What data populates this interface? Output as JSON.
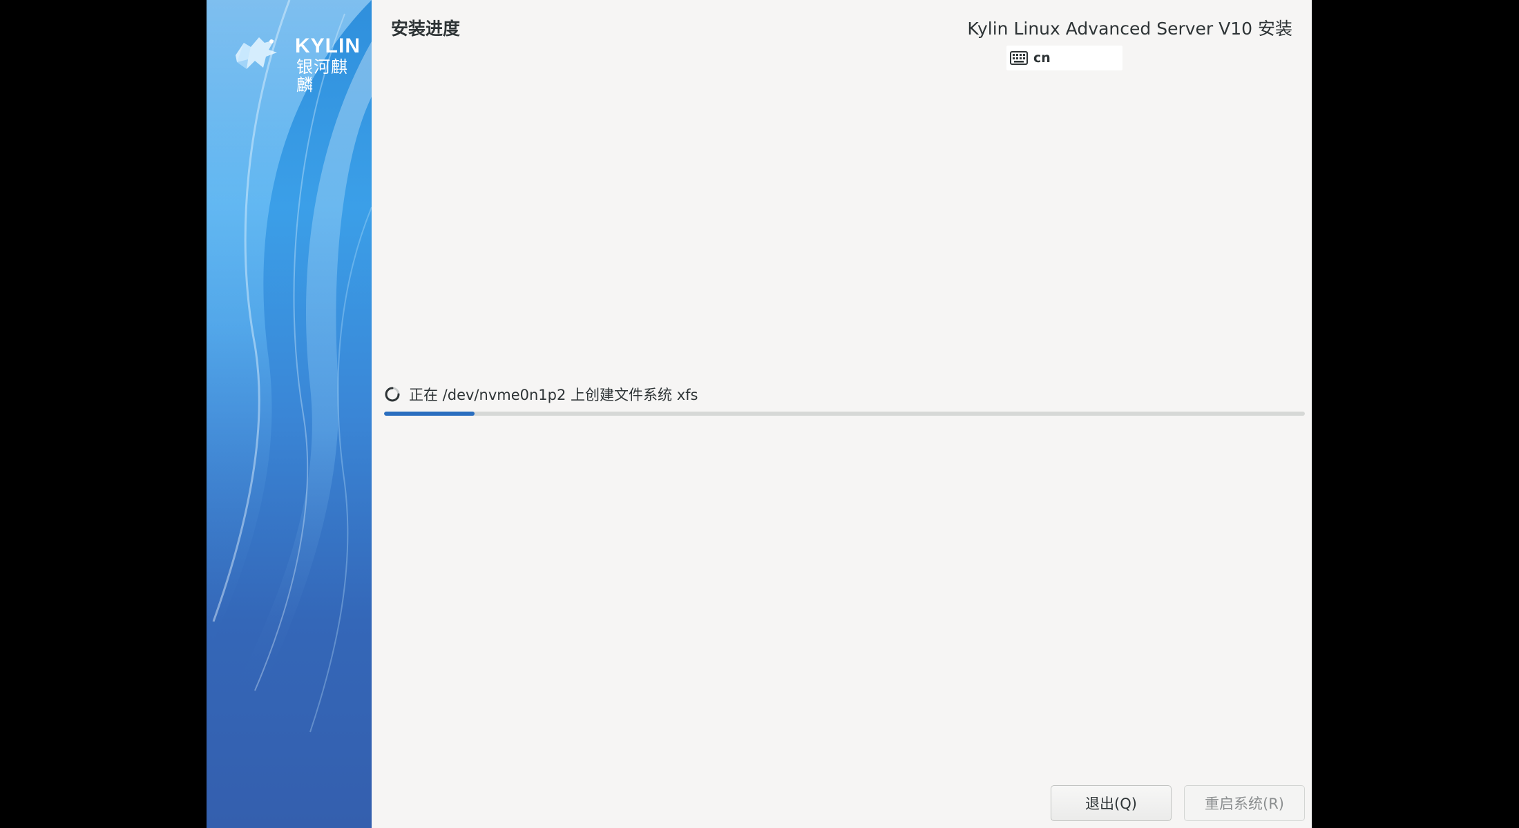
{
  "sidebar": {
    "logo_text": "KYLIN",
    "logo_cn": "银河麒麟"
  },
  "header": {
    "page_title": "安装进度",
    "product_title": "Kylin Linux Advanced Server V10 安装",
    "keyboard_layout": "cn"
  },
  "progress": {
    "status_text": "正在 /dev/nvme0n1p2 上创建文件系统 xfs",
    "fraction": 0.098
  },
  "buttons": {
    "quit_label": "退出(Q)",
    "reboot_label": "重启系统(R)"
  },
  "colors": {
    "accent": "#2a6ebf",
    "sidebar_top": "#2f8fdc",
    "sidebar_bottom": "#345fae",
    "panel_bg": "#f6f5f4"
  },
  "icons": {
    "keyboard": "keyboard-icon",
    "spinner": "spinner-icon",
    "logo": "kylin-logo-icon"
  }
}
